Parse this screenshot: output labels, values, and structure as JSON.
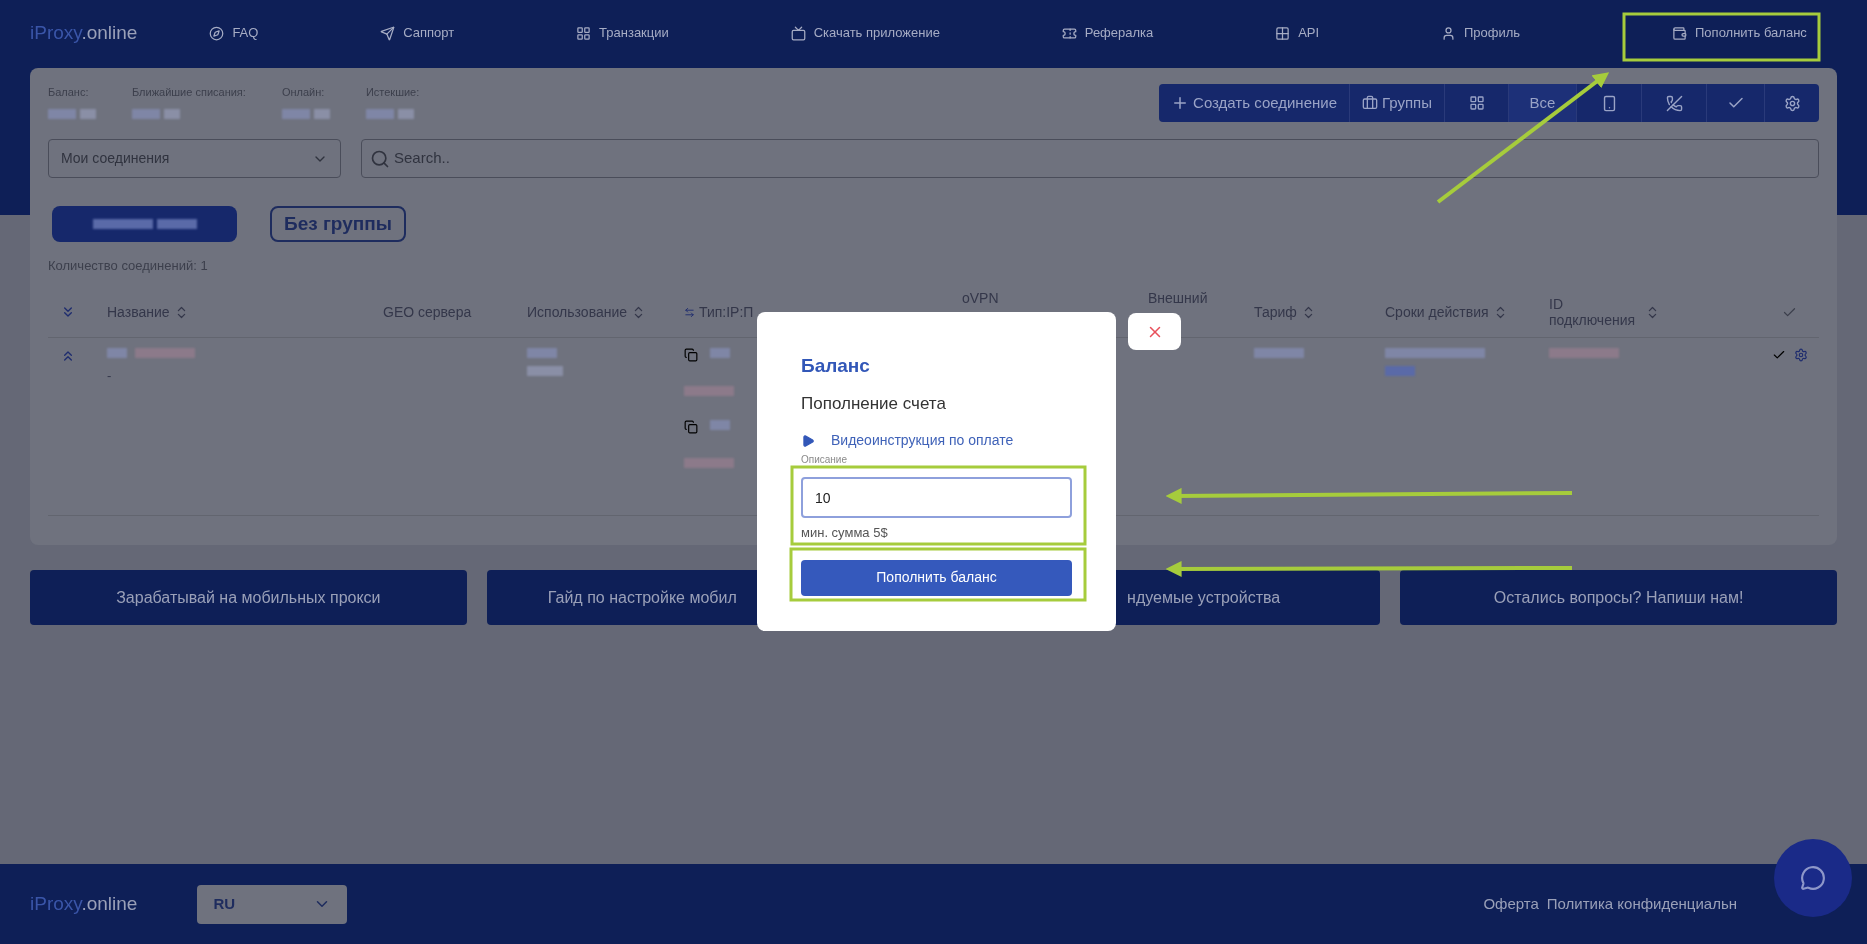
{
  "nav": {
    "logo_brand": "iProxy",
    "logo_suffix": ".online",
    "items": [
      {
        "label": "FAQ"
      },
      {
        "label": "Саппорт"
      },
      {
        "label": "Транзакции"
      },
      {
        "label": "Скачать приложение"
      },
      {
        "label": "Рефералка"
      },
      {
        "label": "API"
      },
      {
        "label": "Профиль"
      }
    ],
    "cta": "Пополнить баланс"
  },
  "stats": [
    {
      "label": "Баланс:"
    },
    {
      "label": "Ближайшие списания:"
    },
    {
      "label": "Онлайн:"
    },
    {
      "label": "Истекшие:"
    }
  ],
  "toolbar": {
    "create": "Создать соединение",
    "groups": "Группы",
    "all": "Все"
  },
  "filters": {
    "select": "Мои соединения",
    "search_placeholder": "Search.."
  },
  "groups": [
    {
      "selected": true
    },
    {
      "label": "Без группы",
      "selected": false
    }
  ],
  "count": "Количество соединений: 1",
  "table": {
    "columns": [
      {
        "label": "Название",
        "sortable": true
      },
      {
        "label": "GEO сервера",
        "sortable": false
      },
      {
        "label": "Использование",
        "sortable": true
      },
      {
        "label": "Тип:IP:П",
        "sortable": false,
        "swap": true
      },
      {
        "label": "oVPN",
        "sortable": false
      },
      {
        "label": "Внешний",
        "sortable": false
      },
      {
        "label": "Тариф",
        "sortable": true
      },
      {
        "label": "Сроки действия",
        "sortable": true
      },
      {
        "label": "ID подключения",
        "sortable": true
      }
    ],
    "rows": [
      {
        "name_extra": "-",
        "expanded": true
      }
    ]
  },
  "promo_buttons": [
    {
      "label": "Зарабатывай на мобильных прокси"
    },
    {
      "label": "Гайд по настройке мобил"
    },
    {
      "label": "ндуемые устройства"
    },
    {
      "label": "Остались вопросы? Напиши нам!"
    }
  ],
  "modal": {
    "title": "Баланс",
    "subtitle": "Пополнение счета",
    "video_link": "Видеоинструкция по оплате",
    "field_label": "Описание",
    "value": "10",
    "hint": "мин. сумма 5$",
    "submit": "Пополнить баланс"
  },
  "footer": {
    "logo_brand": "iProxy",
    "logo_suffix": ".online",
    "language": "RU",
    "links": [
      "Оферта",
      "Политика конфиденциальн"
    ]
  }
}
